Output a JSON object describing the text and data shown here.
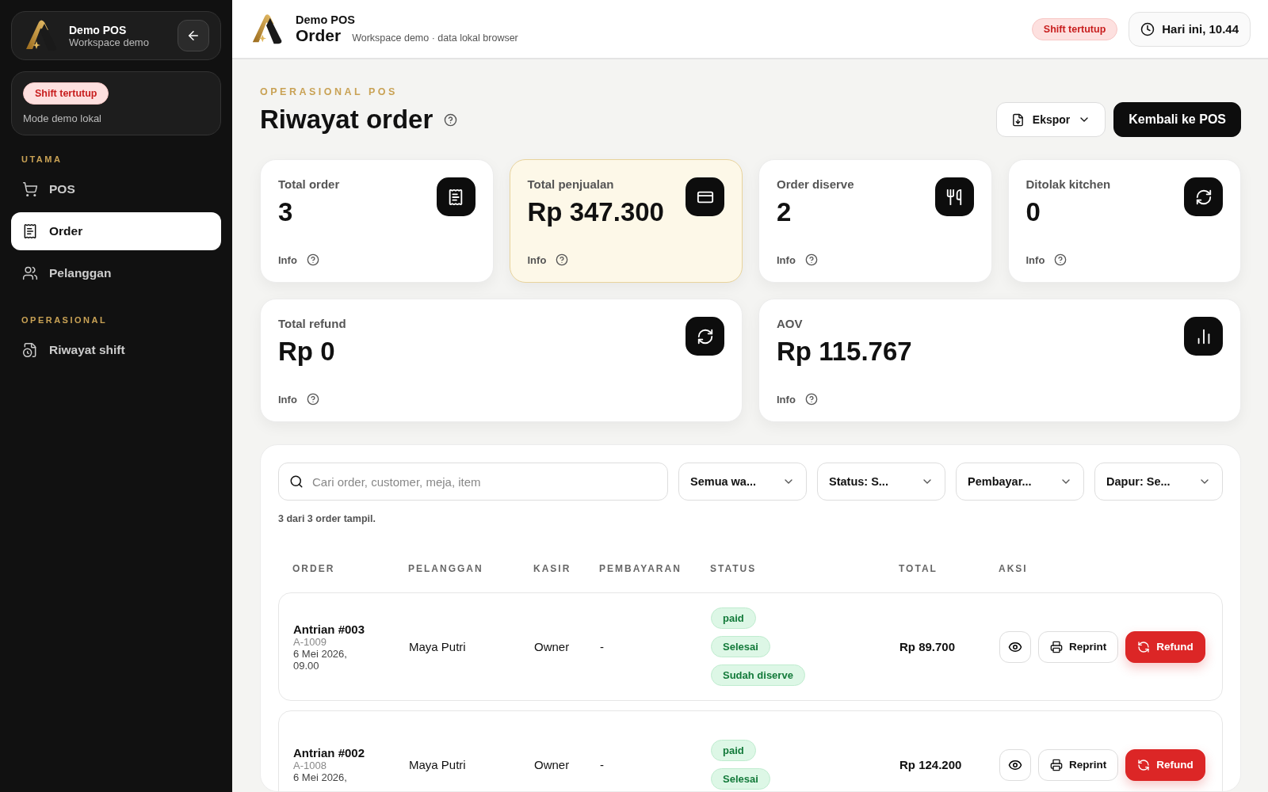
{
  "sidebar": {
    "brand": {
      "name": "Demo POS",
      "subtitle": "Workspace demo"
    },
    "shift": {
      "badge": "Shift tertutup",
      "note": "Mode demo lokal"
    },
    "sections": [
      {
        "heading": "UTAMA",
        "items": [
          {
            "label": "POS",
            "selected": false
          },
          {
            "label": "Order",
            "selected": true
          },
          {
            "label": "Pelanggan",
            "selected": false
          }
        ]
      },
      {
        "heading": "OPERASIONAL",
        "items": [
          {
            "label": "Riwayat shift",
            "selected": false
          }
        ]
      }
    ]
  },
  "header": {
    "app": "Demo POS",
    "title": "Order",
    "subtitle": "Workspace demo · data lokal browser",
    "shift_badge": "Shift tertutup",
    "clock": "Hari ini, 10.44"
  },
  "page": {
    "eyebrow": "OPERASIONAL POS",
    "title": "Riwayat order",
    "export": "Ekspor",
    "back": "Kembali ke POS"
  },
  "stats": [
    {
      "label": "Total order",
      "value": "3",
      "info": "Info",
      "highlighted": false
    },
    {
      "label": "Total penjualan",
      "value": "Rp 347.300",
      "info": "Info",
      "highlighted": true
    },
    {
      "label": "Order diserve",
      "value": "2",
      "info": "Info",
      "highlighted": false
    },
    {
      "label": "Ditolak kitchen",
      "value": "0",
      "info": "Info",
      "highlighted": false
    }
  ],
  "wide_stats": [
    {
      "label": "Total refund",
      "value": "Rp 0",
      "info": "Info",
      "highlighted": false
    },
    {
      "label": "AOV",
      "value": "Rp 115.767",
      "info": "Info",
      "highlighted": false
    }
  ],
  "filters": {
    "search_placeholder": "Cari order, customer, meja, item",
    "selects": [
      "Semua wa...",
      "Status: S...",
      "Pembayar...",
      "Dapur: Se..."
    ],
    "count": "3 dari 3 order tampil."
  },
  "table": {
    "columns": [
      "ORDER",
      "PELANGGAN",
      "KASIR",
      "PEMBAYARAN",
      "STATUS",
      "TOTAL",
      "AKSI"
    ],
    "rows": [
      {
        "order": "Antrian #003",
        "code": "A-1009",
        "date": "6 Mei 2026, 09.00",
        "customer": "Maya Putri",
        "cashier": "Owner",
        "payment": "-",
        "statuses": [
          "paid",
          "Selesai",
          "Sudah diserve"
        ],
        "total": "Rp 89.700",
        "reprint": "Reprint",
        "refund": "Refund"
      },
      {
        "order": "Antrian #002",
        "code": "A-1008",
        "date": "6 Mei 2026,",
        "customer": "Maya Putri",
        "cashier": "Owner",
        "payment": "-",
        "statuses": [
          "paid",
          "Selesai"
        ],
        "total": "Rp 124.200",
        "reprint": "Reprint",
        "refund": "Refund"
      }
    ]
  }
}
